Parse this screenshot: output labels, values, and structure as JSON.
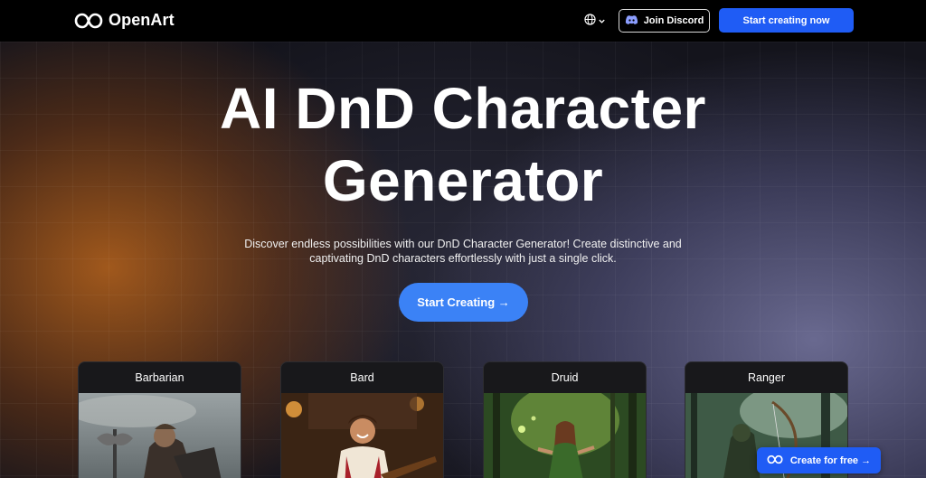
{
  "nav": {
    "brand": "OpenArt",
    "discord_label": "Join Discord",
    "cta_label": "Start creating now"
  },
  "hero": {
    "title_line1": "AI DnD Character",
    "title_line2": "Generator",
    "subtitle_line1": "Discover endless possibilities with our DnD Character Generator! Create distinctive and",
    "subtitle_line2": "captivating DnD characters effortlessly with just a single click.",
    "start_label": "Start Creating →"
  },
  "cards": [
    {
      "label": "Barbarian"
    },
    {
      "label": "Bard"
    },
    {
      "label": "Druid"
    },
    {
      "label": "Ranger"
    }
  ],
  "floating": {
    "label": "Create for free →"
  },
  "colors": {
    "primary": "#1f5cf5",
    "start_button": "#3b82f6"
  }
}
